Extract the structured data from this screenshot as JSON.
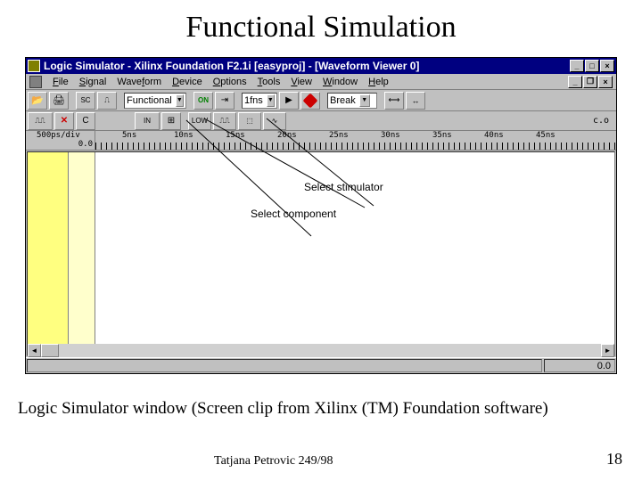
{
  "slide": {
    "title": "Functional Simulation",
    "caption": "Logic Simulator window  (Screen clip from Xilinx (TM) Foundation software)",
    "author": "Tatjana Petrovic 249/98",
    "page": "18"
  },
  "window": {
    "title": "Logic Simulator - Xilinx Foundation F2.1i [easyproj] - [Waveform Viewer 0]"
  },
  "menu": {
    "file": "File",
    "signal": "Signal",
    "waveform": "Waveform",
    "device": "Device",
    "options": "Options",
    "tools": "Tools",
    "view": "View",
    "window": "Window",
    "help": "Help"
  },
  "toolbar": {
    "mode": "Functional",
    "step": "1fns",
    "break": "Break"
  },
  "toolbar2": {
    "position": "c.o"
  },
  "ruler": {
    "div": "500ps/div",
    "start": "0.0",
    "ticks": [
      "5ns",
      "10ns",
      "15ns",
      "20ns",
      "25ns",
      "30ns",
      "35ns",
      "40ns",
      "45ns"
    ]
  },
  "annotations": {
    "sel_stim": "Select stimulator",
    "sel_comp": "Select component"
  },
  "status": {
    "time": "0.0"
  }
}
